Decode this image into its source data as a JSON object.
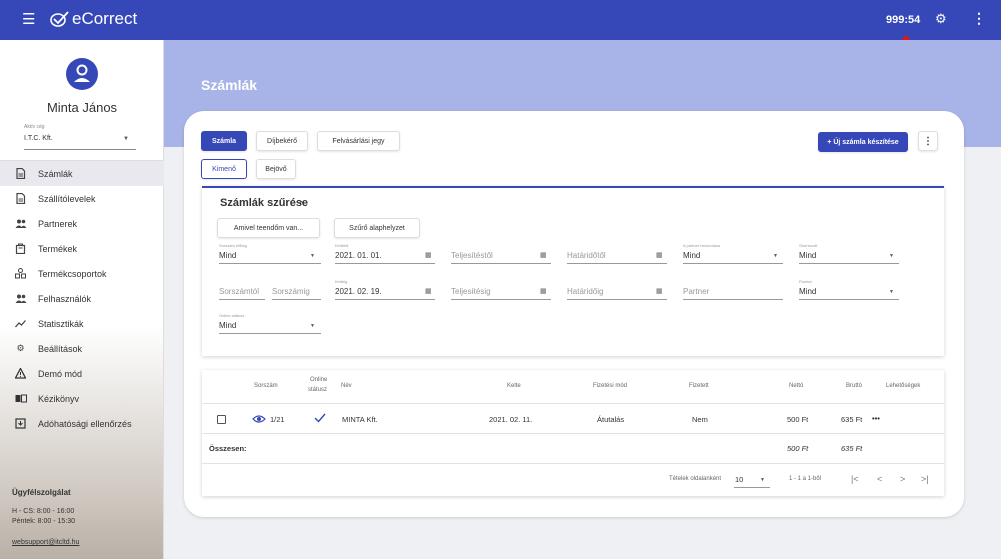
{
  "topbar": {
    "menu_icon": "☰",
    "app_name": "eCorrect",
    "timer": "999:54",
    "gear_icon": "gear-icon",
    "kebab_icon": "kebab-icon"
  },
  "user": {
    "name": "Minta János",
    "company_label": "Aktív cég",
    "company": "I.T.C. Kft."
  },
  "nav": [
    {
      "label": "Számlák",
      "icon": "document-icon"
    },
    {
      "label": "Szállítólevelek",
      "icon": "document-icon"
    },
    {
      "label": "Partnerek",
      "icon": "people-icon"
    },
    {
      "label": "Termékek",
      "icon": "product-icon"
    },
    {
      "label": "Termékcsoportok",
      "icon": "groups-icon"
    },
    {
      "label": "Felhasználók",
      "icon": "people-icon"
    },
    {
      "label": "Statisztikák",
      "icon": "chart-icon"
    },
    {
      "label": "Beállítások",
      "icon": "gear-icon"
    },
    {
      "label": "Demó mód",
      "icon": "warning-icon"
    },
    {
      "label": "Kézikönyv",
      "icon": "book-icon"
    },
    {
      "label": "Adóhatósági ellenőrzés",
      "icon": "inbox-icon"
    }
  ],
  "support": {
    "title": "Ügyfélszolgálat",
    "hours1": "H - CS: 8:00 - 16:00",
    "hours2": "Péntek: 8:00 - 15:30",
    "email": "websupport@itcltd.hu"
  },
  "page": {
    "title": "Számlák"
  },
  "doc_tabs": [
    "Számla",
    "Díjbekérő",
    "Felvásárlási jegy"
  ],
  "dir_tabs": [
    "Kimenő",
    "Bejövő"
  ],
  "new_invoice_label": "+ Új számla készítése",
  "filter": {
    "title": "Számlák szűrése",
    "quick_btn": "Amivel teendőm van...",
    "reset_btn": "Szűrő alaphelyzet",
    "f_prefix_label": "Sorszám előtag",
    "f_prefix_value": "Mind",
    "f_from_label": "Keltétől",
    "f_from_value": "2021. 01. 01.",
    "f_perf_from": "Teljesítéstől",
    "f_due_from": "Határidőtől",
    "f_partner_cls_label": "A partner besorolása",
    "f_partner_cls_value": "Mind",
    "f_storno_label": "Stornózott",
    "f_storno_value": "Mind",
    "f_num_from": "Sorszámtól",
    "f_num_to": "Sorszámig",
    "f_to_label": "Keltéig",
    "f_to_value": "2021. 02. 19.",
    "f_perf_to": "Teljesítésig",
    "f_due_to": "Határidőig",
    "f_partner": "Partner",
    "f_paid_label": "Fizetve",
    "f_paid_value": "Mind",
    "f_online_label": "Online státusz",
    "f_online_value": "Mind"
  },
  "table": {
    "headers": {
      "number": "Sorszám",
      "online1": "Online",
      "online2": "státusz",
      "name": "Név",
      "date": "Kelte",
      "method": "Fizetési mód",
      "paid": "Fizetett",
      "net": "Nettó",
      "gross": "Bruttó",
      "options": "Lehetőségek"
    },
    "rows": [
      {
        "number": "1/21",
        "name": "MINTA Kft.",
        "date": "2021. 02. 11.",
        "method": "Átutalás",
        "paid": "Nem",
        "net": "500 Ft",
        "gross": "635 Ft",
        "options": "•••"
      }
    ],
    "total_label": "Összesen:",
    "total_net": "500 Ft",
    "total_gross": "635 Ft",
    "per_page_label": "Tételek oldalanként",
    "per_page": "10",
    "range": "1 - 1 a 1-ből"
  },
  "colors": {
    "primary": "#3648b8",
    "banner": "#a8b4e8",
    "arrow": "#e8141b"
  }
}
